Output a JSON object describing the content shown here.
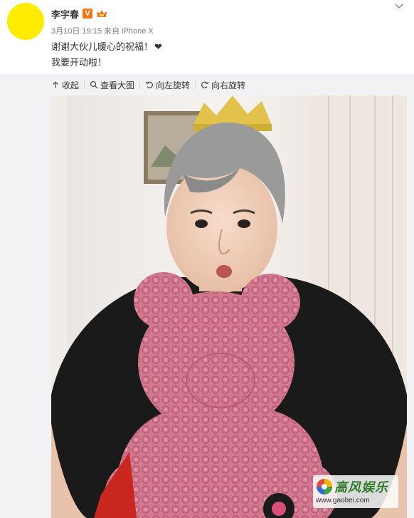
{
  "post": {
    "author": "李宇春",
    "verified_badge": "V",
    "date": "3月10日 19:15",
    "via_prefix": "来自",
    "device": "iPhone X",
    "text_line1": "谢谢大伙儿暖心的祝福！",
    "heart": "❤",
    "text_line2": "我要开动啦！"
  },
  "toolbar": {
    "collapse": "收起",
    "view_large": "查看大图",
    "rotate_left": "向左旋转",
    "rotate_right": "向右旋转"
  },
  "watermark": {
    "title": "高风娱乐",
    "url": "www.gaobei.com"
  },
  "colors": {
    "avatar": "#ffec00",
    "verified": "#f3761f",
    "cake": "#d2788f",
    "shirt": "#1a1a1a",
    "hair": "#9a9a9a"
  }
}
